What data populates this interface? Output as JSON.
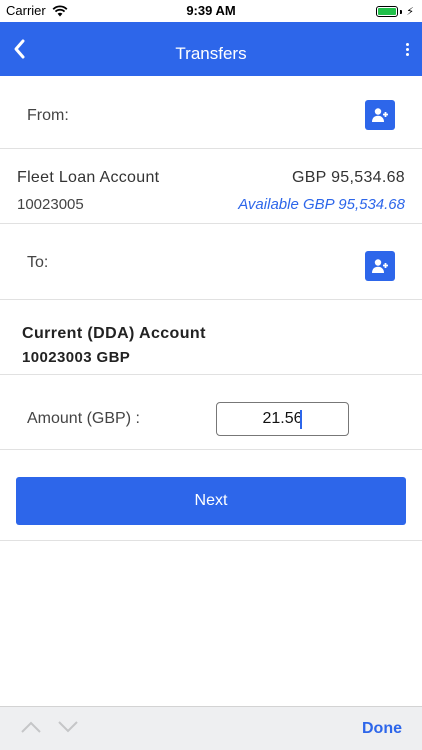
{
  "status": {
    "carrier": "Carrier",
    "time": "9:39 AM"
  },
  "nav": {
    "title": "Transfers"
  },
  "from": {
    "label": "From:",
    "account_name": "Fleet Loan Account",
    "balance": "GBP 95,534.68",
    "account_number": "10023005",
    "available": "Available GBP 95,534.68"
  },
  "to": {
    "label": "To:",
    "account_name": "Current (DDA) Account",
    "account_number": "10023003 GBP"
  },
  "amount": {
    "label": "Amount (GBP) :",
    "value": "21.56"
  },
  "actions": {
    "next_label": "Next"
  },
  "keyboard": {
    "done_label": "Done"
  },
  "colors": {
    "primary": "#2d66ea",
    "battery": "#21c04a",
    "divider": "#e1e1e1"
  }
}
